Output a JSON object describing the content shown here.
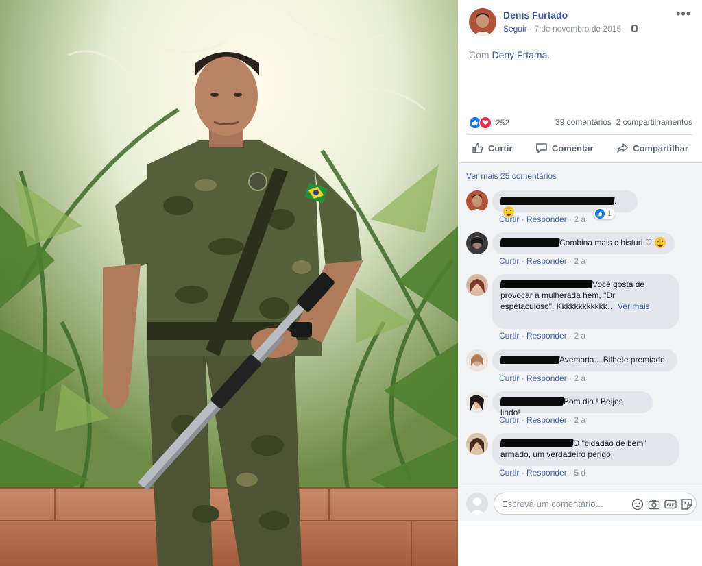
{
  "post": {
    "author": "Denis Furtado",
    "follow_label": "Seguir",
    "meta_sep": " · ",
    "date": "7 de novembro de 2015",
    "meta_sep2": " · ",
    "with_prefix": "Com ",
    "tagged": "Deny Frtama",
    "tagged_suffix": ".",
    "reaction_count": "252",
    "comments_count": "39 comentários",
    "shares_count": "2 compartilhamentos",
    "actions": {
      "like": "Curtir",
      "comment": "Comentar",
      "share": "Compartilhar"
    }
  },
  "comments": {
    "see_more": "Ver mais 25 comentários",
    "like_label": "Curtir",
    "reply_label": "Responder",
    "dot": " · ",
    "items": [
      {
        "text": ".",
        "age": "2 a",
        "likes": "1"
      },
      {
        "text": "Combina mais c bisturi ♡",
        "age": "2 a"
      },
      {
        "text": "Você gosta de provocar a mulherada hem, \"Dr espetaculoso\". Kkkkkkkkkkkk…",
        "see_more": "Ver mais",
        "age": "2 a"
      },
      {
        "text": "Avemaria....Bilhete premiado",
        "age": "2 a"
      },
      {
        "text": "Bom dia ! Beijos lindo!",
        "age": "2 a"
      },
      {
        "text": "O \"cidadão de bem\" armado, um verdadeiro perigo!",
        "age": "5 d"
      }
    ]
  },
  "composer": {
    "placeholder": "Escreva um comentário..."
  },
  "colors": {
    "link": "#365899",
    "like_blue": "#1877f2",
    "love_red": "#f0284a",
    "bubble": "#e4e6eb"
  },
  "icons": [
    "more-options-icon",
    "globe-icon",
    "like-icon",
    "comment-icon",
    "share-icon",
    "emoji-icon",
    "camera-icon",
    "gif-icon",
    "sticker-icon"
  ]
}
